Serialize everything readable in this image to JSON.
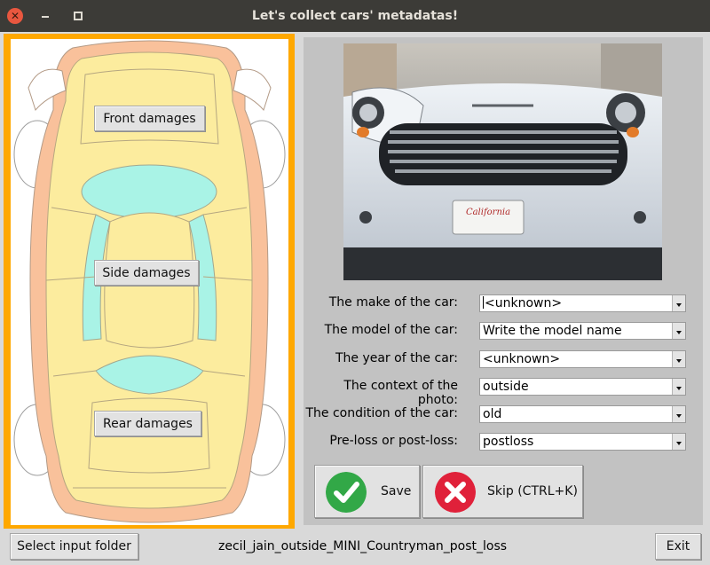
{
  "window": {
    "title": "Let's collect cars' metadatas!"
  },
  "damage_buttons": {
    "front": "Front damages",
    "side": "Side damages",
    "rear": "Rear damages"
  },
  "photo": {
    "plate_text": "California"
  },
  "form": {
    "fields": [
      {
        "label": "The make of the car:",
        "value": "<unknown>"
      },
      {
        "label": "The model of the car:",
        "value": "Write the model name"
      },
      {
        "label": "The year of the car:",
        "value": "<unknown>"
      },
      {
        "label": "The context of the photo:",
        "value": "outside"
      },
      {
        "label": "The condition of the car:",
        "value": "old"
      },
      {
        "label": "Pre-loss or post-loss:",
        "value": "postloss"
      }
    ]
  },
  "actions": {
    "save_label": "Save",
    "skip_label": "Skip (CTRL+K)"
  },
  "bottom": {
    "select_folder_label": "Select input folder",
    "filename": "zecil_jain_outside_MINI_Countryman_post_loss",
    "exit_label": "Exit"
  },
  "icons": {
    "close": "close-icon",
    "minimize": "minimize-icon",
    "maximize": "maximize-icon",
    "save": "check-icon",
    "skip": "x-icon"
  },
  "colors": {
    "left_frame": "#ffa800",
    "car_body": "#fcec9e",
    "car_trim": "#f9c19b",
    "car_glass": "#a9f3e6",
    "save_icon": "#32a847",
    "skip_icon": "#e0213a",
    "titlebar": "#3c3b37"
  }
}
